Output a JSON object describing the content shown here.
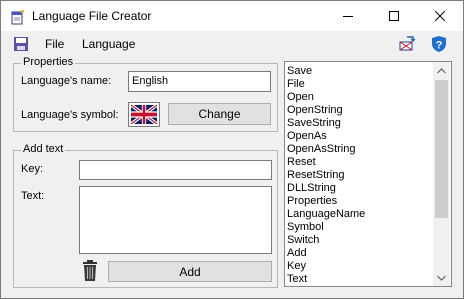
{
  "window": {
    "title": "Language File Creator"
  },
  "menu": {
    "file_label": "File",
    "language_label": "Language"
  },
  "icons": {
    "app": "notepad-icon",
    "save": "floppy-disk-icon",
    "switch": "switch-language-icon",
    "help": "help-shield-icon"
  },
  "properties": {
    "group_title": "Properties",
    "name_label": "Language's name:",
    "name_value": "English",
    "symbol_label": "Language's symbol:",
    "change_button": "Change"
  },
  "add_text": {
    "group_title": "Add text",
    "key_label": "Key:",
    "key_value": "",
    "text_label": "Text:",
    "text_value": "",
    "add_button": "Add"
  },
  "keys_list": [
    "Save",
    "File",
    "Open",
    "OpenString",
    "SaveString",
    "OpenAs",
    "OpenAsString",
    "Reset",
    "ResetString",
    "DLLString",
    "Properties",
    "LanguageName",
    "Symbol",
    "Switch",
    "Add",
    "Key",
    "Text"
  ]
}
